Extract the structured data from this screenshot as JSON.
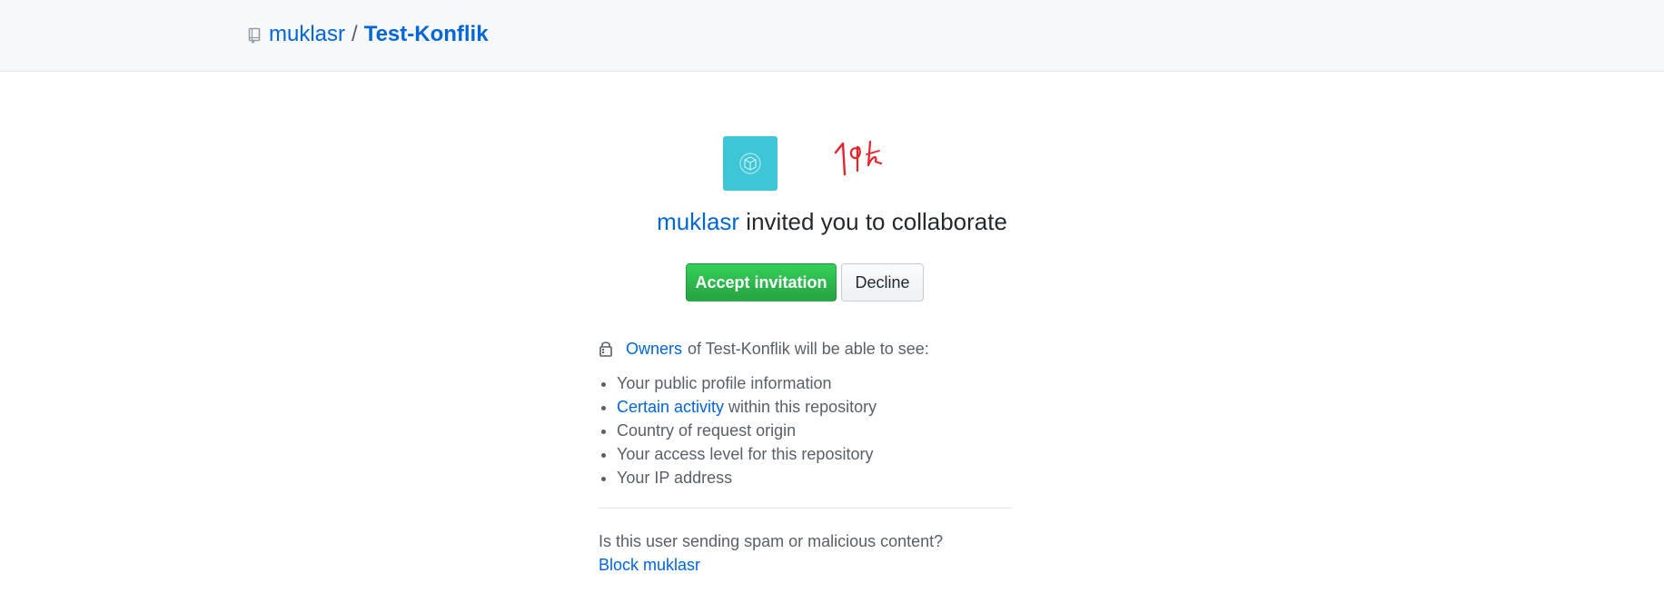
{
  "header": {
    "owner": "muklasr",
    "separator": "/",
    "repo": "Test-Konflik"
  },
  "invite": {
    "inviter": "muklasr",
    "message": " invited you to collaborate"
  },
  "actions": {
    "accept_label": "Accept invitation",
    "decline_label": "Decline"
  },
  "permissions": {
    "owners_link": "Owners",
    "lead_text": "of Test-Konflik will be able to see:",
    "items": [
      {
        "text": "Your public profile information"
      },
      {
        "link": "Certain activity",
        "text": " within this repository"
      },
      {
        "text": "Country of request origin"
      },
      {
        "text": "Your access level for this repository"
      },
      {
        "text": "Your IP address"
      }
    ]
  },
  "spam": {
    "question": "Is this user sending spam or malicious content?",
    "block_label": "Block muklasr"
  },
  "colors": {
    "link": "#0366d6",
    "accept_button": "#28a745",
    "avatar_bg": "#3fc6d6",
    "signature": "#e8232a"
  },
  "icons": {
    "repo": "repo-icon",
    "lock": "lock-icon",
    "avatar": "box-avatar-icon"
  }
}
